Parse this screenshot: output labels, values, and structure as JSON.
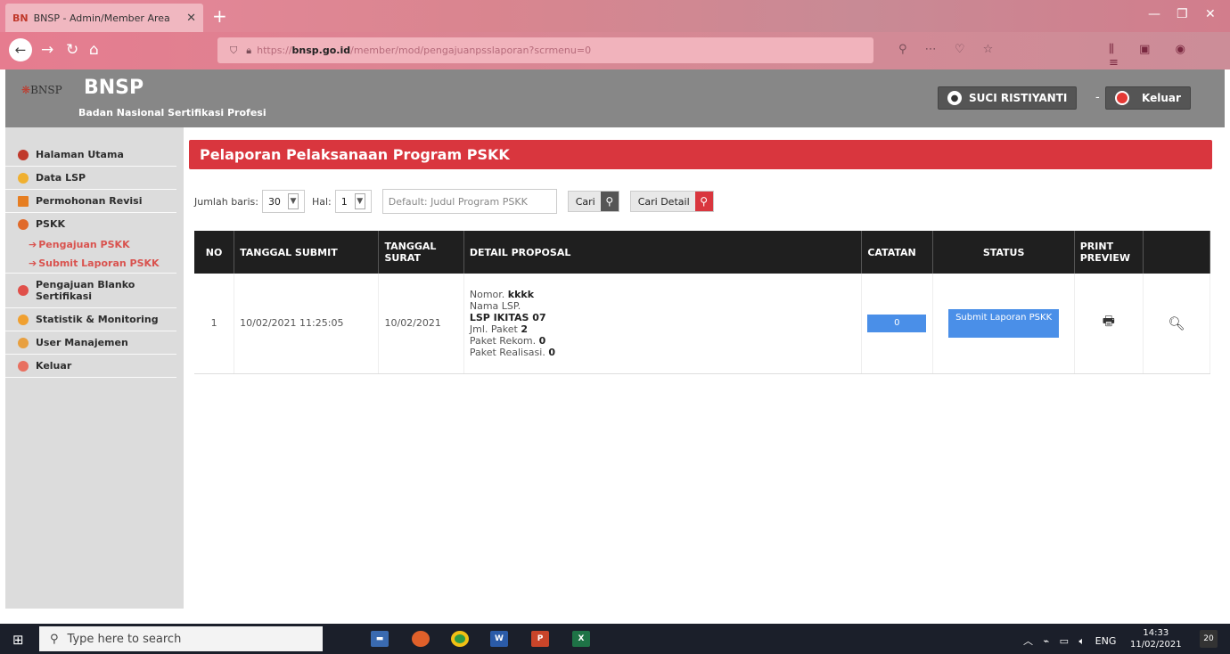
{
  "browser": {
    "tab_title": "BNSP - Admin/Member Area",
    "tab_icon": "BN",
    "url_prefix": "https://",
    "url_domain": "bnsp.go.id",
    "url_path": "/member/mod/pengajuanpsslaporan?scrmenu=0"
  },
  "header": {
    "logo_text": "BNSP",
    "title": "BNSP",
    "subtitle": "Badan Nasional Sertifikasi Profesi",
    "user_name": "SUCI RISTIYANTI",
    "logout_label": "Keluar"
  },
  "sidebar": {
    "items": [
      {
        "label": "Halaman Utama",
        "color": "#c0392b"
      },
      {
        "label": "Data LSP",
        "color": "#f0b030"
      },
      {
        "label": "Permohonan Revisi",
        "color": "#e67e22"
      },
      {
        "label": "PSKK",
        "color": "#e06a2a"
      },
      {
        "label": "Pengajuan Blanko Sertifikasi",
        "color": "#e0504a"
      },
      {
        "label": "Statistik & Monitoring",
        "color": "#f0a030"
      },
      {
        "label": "User Manajemen",
        "color": "#e8a040"
      },
      {
        "label": "Keluar",
        "color": "#e87060"
      }
    ],
    "sub_items": [
      "Pengajuan PSKK",
      "Submit Laporan PSKK"
    ]
  },
  "main": {
    "title": "Pelaporan Pelaksanaan Program PSKK",
    "filter": {
      "rows_label": "Jumlah baris:",
      "rows_value": "30",
      "page_label": "Hal:",
      "page_value": "1",
      "search_placeholder": "Default: Judul Program PSKK",
      "search_button": "Cari",
      "detail_button": "Cari Detail"
    },
    "table": {
      "headers": [
        "NO",
        "TANGGAL SUBMIT",
        "TANGGAL SURAT",
        "DETAIL PROPOSAL",
        "CATATAN",
        "STATUS",
        "PRINT PREVIEW",
        ""
      ],
      "rows": [
        {
          "no": "1",
          "tanggal_submit": "10/02/2021 11:25:05",
          "tanggal_surat": "10/02/2021",
          "nomor_label": "Nomor.",
          "nomor_value": "kkkk",
          "nama_label": "Nama LSP.",
          "nama_value": "LSP IKITAS 07",
          "paket_label": "Jml. Paket",
          "paket_value": "2",
          "rekom_label": "Paket Rekom.",
          "rekom_value": "0",
          "realisasi_label": "Paket Realisasi.",
          "realisasi_value": "0",
          "catatan": "0",
          "status": "Submit Laporan PSKK"
        }
      ]
    }
  },
  "taskbar": {
    "search_placeholder": "Type here to search",
    "time": "14:33",
    "date": "11/02/2021",
    "lang": "ENG",
    "notif_count": "20"
  }
}
